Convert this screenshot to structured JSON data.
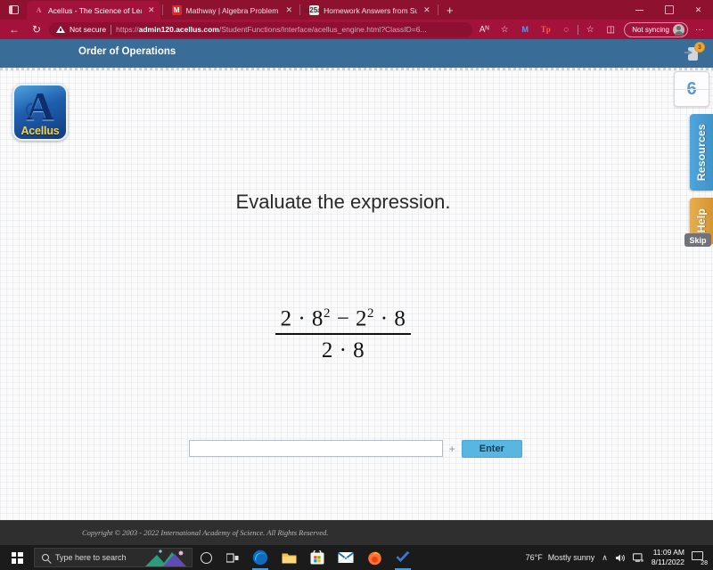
{
  "browser": {
    "tabs": [
      {
        "title": "Acellus - The Science of Learning",
        "favicon": "acellus-icon",
        "active": true,
        "close_label": "✕"
      },
      {
        "title": "Mathway | Algebra Problem Solv",
        "favicon": "mathway-icon",
        "active": false,
        "close_label": "✕"
      },
      {
        "title": "Homework Answers from Subjec",
        "favicon": "homework-icon",
        "active": false,
        "close_label": "✕"
      }
    ],
    "new_tab_label": "+",
    "window_controls": {
      "minimize": "–",
      "maximize": "❐",
      "close": "✕"
    },
    "nav": {
      "back": "←",
      "refresh": "↻"
    },
    "security_label": "Not secure",
    "url_scheme": "https://",
    "url_host": "admin120.acellus.com",
    "url_path": "/StudentFunctions/Interface/acellus_engine.html?ClassID=6...",
    "toolbar_icons": {
      "read_aloud": "Aᴺ",
      "favorites": "☆",
      "office": "M",
      "tp": "Tp",
      "collections": "◴",
      "split_screen": "❑"
    },
    "profile_label": "Not syncing",
    "more_label": "···"
  },
  "app": {
    "lesson_title": "Order of Operations",
    "logo": {
      "letter": "A",
      "wordmark": "Acellus"
    },
    "notification_badge": "3",
    "prompt": "Evaluate the expression.",
    "expression": {
      "numerator_parts": [
        {
          "text": "2 · 8",
          "sup": "2"
        },
        {
          "text": " − 2",
          "sup": "2"
        },
        {
          "text": " · 8",
          "sup": ""
        }
      ],
      "numerator_plain": "2 · 8² − 2² · 8",
      "denominator": "2 · 8"
    },
    "answer_value": "",
    "answer_placeholder": "",
    "plus_label": "+",
    "enter_label": "Enter",
    "problem_counter": "6",
    "side_tabs": {
      "resources": "Resources",
      "help": "Help",
      "skip": "Skip"
    },
    "footer": "Copyright © 2003 - 2022 International Academy of Science.  All Rights Reserved.",
    "colors": {
      "header_blue": "#3a6c98",
      "resources_blue": "#4fa6dc",
      "help_orange": "#d4952f",
      "skip_gray": "#707379",
      "enter_blue": "#59b6e0",
      "counter_blue": "#5b9bd5"
    }
  },
  "taskbar": {
    "start_label": "Start",
    "search_placeholder": "Type here to search",
    "cortana_label": "Cortana",
    "taskview_label": "Task View",
    "apps": [
      {
        "name": "edge",
        "glyph": "e",
        "open": true
      },
      {
        "name": "file-explorer",
        "glyph": "☰",
        "open": false
      },
      {
        "name": "microsoft-store",
        "glyph": "⊞",
        "open": false
      },
      {
        "name": "mail",
        "glyph": "✉",
        "open": false
      },
      {
        "name": "firefox",
        "glyph": "●",
        "open": false
      },
      {
        "name": "todo",
        "glyph": "✔",
        "open": true
      }
    ],
    "weather_temp": "76°F",
    "weather_desc": "Mostly sunny",
    "tray": {
      "chevron": "∧",
      "volume": "🔊",
      "network": "⎕"
    },
    "time": "11:09 AM",
    "date": "8/11/2022",
    "notification_count": "28"
  }
}
